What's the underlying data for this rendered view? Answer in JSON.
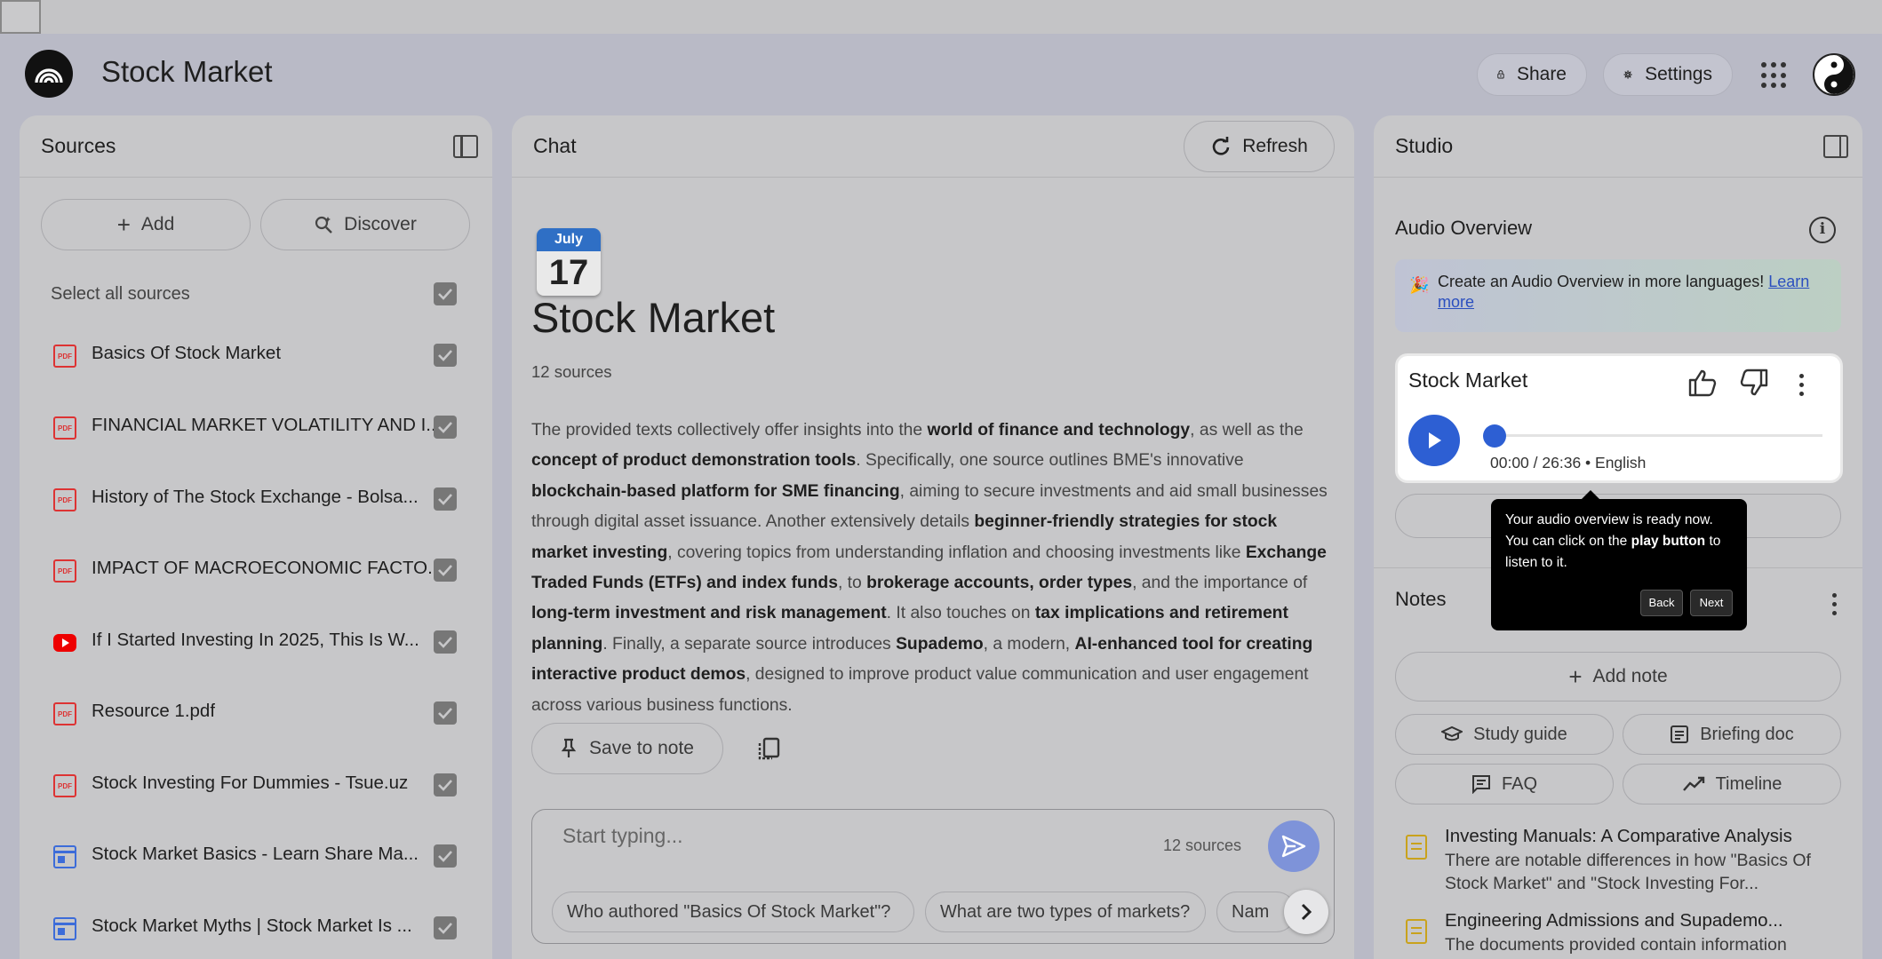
{
  "app": {
    "title": "Stock Market"
  },
  "header": {
    "share_label": "Share",
    "settings_label": "Settings"
  },
  "sources": {
    "title": "Sources",
    "add_label": "Add",
    "discover_label": "Discover",
    "select_all_label": "Select all sources",
    "items": [
      {
        "label": "Basics Of Stock Market",
        "type": "pdf-icon"
      },
      {
        "label": "FINANCIAL MARKET VOLATILITY AND I...",
        "type": "pdf-icon"
      },
      {
        "label": "History of The Stock Exchange - Bolsa...",
        "type": "pdf-icon"
      },
      {
        "label": "IMPACT OF MACROECONOMIC FACTO...",
        "type": "pdf-icon"
      },
      {
        "label": "If I Started Investing In 2025, This Is W...",
        "type": "youtube-icon"
      },
      {
        "label": "Resource 1.pdf",
        "type": "pdf-icon"
      },
      {
        "label": "Stock Investing For Dummies - Tsue.uz",
        "type": "pdf-icon"
      },
      {
        "label": "Stock Market Basics - Learn Share Ma...",
        "type": "web-icon"
      },
      {
        "label": "Stock Market Myths | Stock Market Is ...",
        "type": "web-icon"
      }
    ]
  },
  "chat": {
    "title": "Chat",
    "refresh_label": "Refresh",
    "calendar": {
      "month": "July",
      "day": "17"
    },
    "notebook_title": "Stock Market",
    "source_count": "12 sources",
    "summary": {
      "p1": "The provided texts collectively offer insights into the ",
      "b1": "world of finance and technology",
      "p2": ", as well as the ",
      "b2": "concept of product demonstration tools",
      "p3": ". Specifically, one source outlines BME's innovative ",
      "b3": "blockchain-based platform for SME financing",
      "p4": ", aiming to secure investments and aid small businesses through digital asset issuance. Another extensively details ",
      "b4": "beginner-friendly strategies for stock market investing",
      "p5": ", covering topics from understanding inflation and choosing investments like ",
      "b5": "Exchange Traded Funds (ETFs) and index funds",
      "p6": ", to ",
      "b6": "brokerage accounts, order types",
      "p7": ", and the importance of ",
      "b7": "long-term investment and risk management",
      "p8": ". It also touches on ",
      "b8": "tax implications and retirement planning",
      "p9": ". Finally, a separate source introduces ",
      "b9": "Supademo",
      "p10": ", a modern, ",
      "b10": "AI-enhanced tool for creating interactive product demos",
      "p11": ", designed to improve product value communication and user engagement across various business functions."
    },
    "save_note_label": "Save to note",
    "composer": {
      "placeholder": "Start typing...",
      "source_count": "12 sources",
      "suggestions": [
        "Who authored \"Basics Of Stock Market\"?",
        "What are two types of markets?",
        "Nam"
      ]
    }
  },
  "studio": {
    "title": "Studio",
    "audio_overview_label": "Audio Overview",
    "banner": {
      "emoji": "🎉",
      "text": "Create an Audio Overview in more languages! ",
      "link": "Learn more"
    },
    "audio_card": {
      "title": "Stock Market",
      "meta": "00:00 / 26:36 • English",
      "progress": 0
    },
    "tooltip": {
      "t1": "Your audio overview is ready now. You can click on the ",
      "b1": "play button",
      "t2": " to listen to it.",
      "back_label": "Back",
      "next_label": "Next"
    },
    "notes_label": "Notes",
    "add_note_label": "Add note",
    "chips": {
      "study_guide": "Study guide",
      "briefing_doc": "Briefing doc",
      "faq": "FAQ",
      "timeline": "Timeline"
    },
    "notes": [
      {
        "title": "Investing Manuals: A Comparative Analysis",
        "body": "There are notable differences in how \"Basics Of Stock Market\" and \"Stock Investing For..."
      },
      {
        "title": "Engineering Admissions and Supademo...",
        "body": "The documents provided contain information"
      }
    ]
  },
  "colors": {
    "accent": "#2d5fd3",
    "send_button": "#7e93d9",
    "background": "#b9bac6",
    "panel": "#c7c7c9"
  }
}
